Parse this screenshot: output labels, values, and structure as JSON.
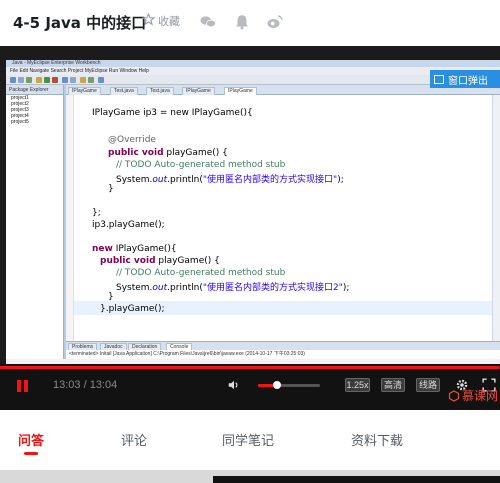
{
  "header": {
    "title": "4-5 Java 中的接口",
    "favorite_label": "收藏"
  },
  "popout": {
    "label": "窗口弹出"
  },
  "eclipse": {
    "window_title": "Java - MyEclipse Enterprise Workbench",
    "menu": "File  Edit  Navigate  Search  Project  MyEclipse  Run  Window  Help",
    "package_explorer": "Package Explorer",
    "projects": [
      "project1",
      "project2",
      "project3",
      "project4",
      "project5"
    ],
    "tabs": [
      "IPlayGame",
      "Test.java",
      "Test.java",
      "IPlayGame",
      "IPlayGame"
    ],
    "bottom_tabs": [
      "Problems",
      "Javadoc",
      "Declaration",
      "Console"
    ],
    "console_text": "<terminated> Initail [Java Application] C:\\Program Files\\Java\\jre6\\bin\\javaw.exe (2014-10-17 下午03:25:03)"
  },
  "code": {
    "l1": "IPlayGame ip3 = new IPlayGame(){",
    "l2": "@Override",
    "l3a": "public void",
    "l3b": " playGame() {",
    "l4": "// TODO Auto-generated method stub",
    "l5a": "System.",
    "l5b": "out",
    "l5c": ".println(",
    "l5d": "\"使用匿名内部类的方式实现接口\"",
    "l5e": ");",
    "l6": "}",
    "l7": "};",
    "l8": "ip3.playGame();",
    "l9a": "new",
    "l9b": " IPlayGame(){",
    "l10a": "public void",
    "l10b": " playGame() {",
    "l11": "// TODO Auto-generated method stub",
    "l12a": "System.",
    "l12b": "out",
    "l12c": ".println(",
    "l12d": "\"使用匿名内部类的方式实现接口2\"",
    "l12e": ");",
    "l13": "}",
    "l14": "}.playGame();"
  },
  "watermark": {
    "label": "慕课网"
  },
  "player": {
    "time": "13:03 / 13:04",
    "progress": 0.998,
    "volume": 0.3,
    "speed": "1.25x",
    "quality": "高清",
    "route": "线路",
    "accent": "#f01414"
  },
  "tabs": {
    "qa": "问答",
    "comments": "评论",
    "notes": "同学笔记",
    "downloads": "资料下载"
  }
}
